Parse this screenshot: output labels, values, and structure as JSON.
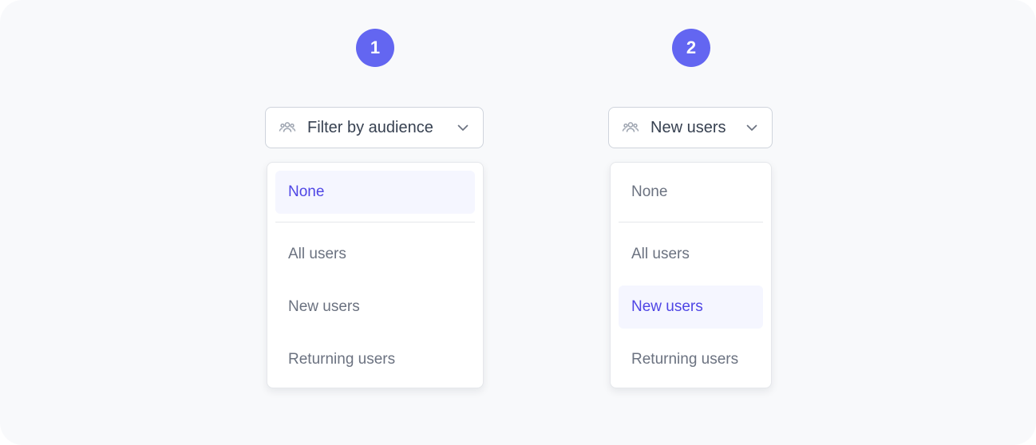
{
  "accent_color": "#6366f1",
  "selected_text_color": "#4f46e5",
  "dropdowns": [
    {
      "step": "1",
      "trigger_icon": "users-icon",
      "trigger_label": "Filter by audience",
      "chevron_icon": "chevron-down-icon",
      "selected_option": "None",
      "options": [
        "None",
        "All users",
        "New users",
        "Returning users"
      ]
    },
    {
      "step": "2",
      "trigger_icon": "users-icon",
      "trigger_label": "New users",
      "chevron_icon": "chevron-down-icon",
      "selected_option": "New users",
      "options": [
        "None",
        "All users",
        "New users",
        "Returning users"
      ]
    }
  ]
}
